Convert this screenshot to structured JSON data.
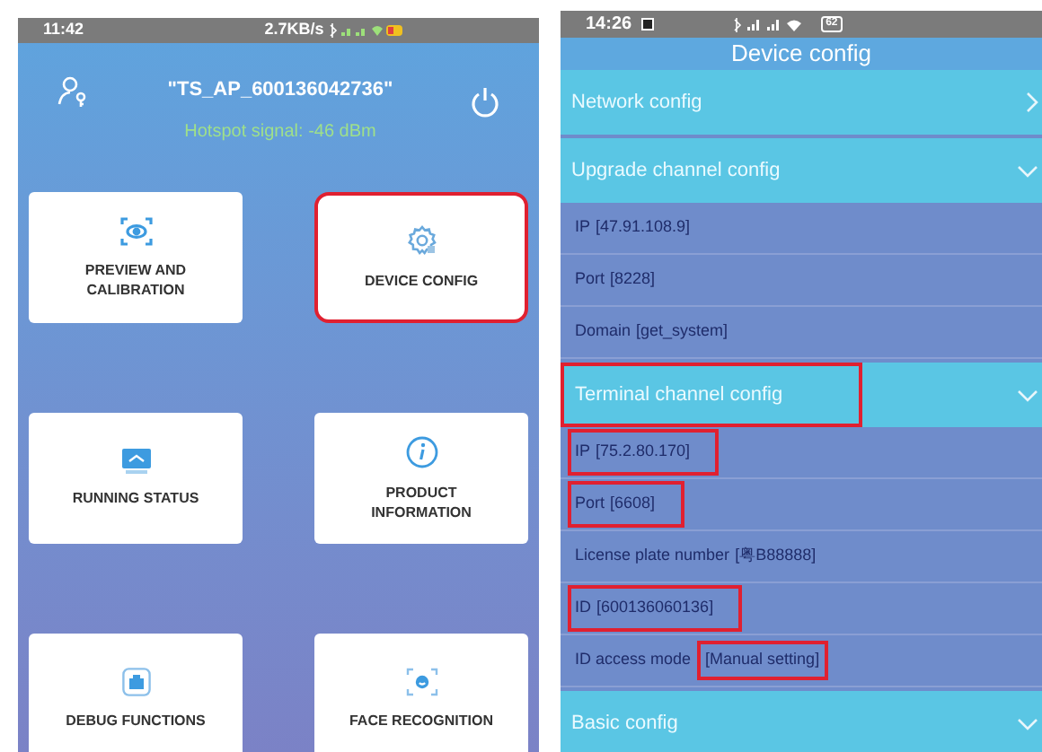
{
  "home_screen": {
    "status_bar": {
      "time": "11:42",
      "speed": "2.7KB/s"
    },
    "hotspot_name": "\"TS_AP_600136042736\"",
    "hotspot_signal": "Hotspot signal: -46 dBm",
    "cards": [
      {
        "kind": "preview",
        "label": "PREVIEW AND CALIBRATION",
        "highlighted": false
      },
      {
        "kind": "config",
        "label": "DEVICE CONFIG",
        "highlighted": true
      },
      {
        "kind": "status",
        "label": "RUNNING STATUS",
        "highlighted": false
      },
      {
        "kind": "info",
        "label": "PRODUCT INFORMATION",
        "highlighted": false
      },
      {
        "kind": "debug",
        "label": "DEBUG FUNCTIONS",
        "highlighted": false
      },
      {
        "kind": "face",
        "label": "FACE RECOGNITION",
        "highlighted": false
      }
    ]
  },
  "config_screen": {
    "status_bar": {
      "time": "14:26",
      "battery": "62"
    },
    "title": "Device config",
    "sections": [
      {
        "title": "Network config",
        "expanded": false,
        "highlighted": false
      },
      {
        "title": "Upgrade channel config",
        "expanded": true,
        "highlighted": false,
        "rows": [
          {
            "label": "IP",
            "value": "[47.91.108.9]",
            "highlighted": false,
            "value_highlighted": false
          },
          {
            "label": "Port",
            "value": "[8228]",
            "highlighted": false,
            "value_highlighted": false
          },
          {
            "label": "Domain",
            "value": "[get_system]",
            "highlighted": false,
            "value_highlighted": false
          }
        ]
      },
      {
        "title": "Terminal channel config",
        "expanded": true,
        "highlighted": true,
        "rows": [
          {
            "label": "IP",
            "value": "[75.2.80.170]",
            "highlighted": true,
            "value_highlighted": false
          },
          {
            "label": "Port",
            "value": "[6608]",
            "highlighted": true,
            "value_highlighted": false
          },
          {
            "label": "License plate number",
            "value": "[粤B88888]",
            "highlighted": false,
            "value_highlighted": false
          },
          {
            "label": "ID",
            "value": "[600136060136]",
            "highlighted": true,
            "value_highlighted": false
          },
          {
            "label": "ID access mode",
            "value": "[Manual setting]",
            "highlighted": false,
            "value_highlighted": true
          }
        ]
      },
      {
        "title": "Basic config",
        "expanded": true,
        "highlighted": false
      }
    ]
  }
}
